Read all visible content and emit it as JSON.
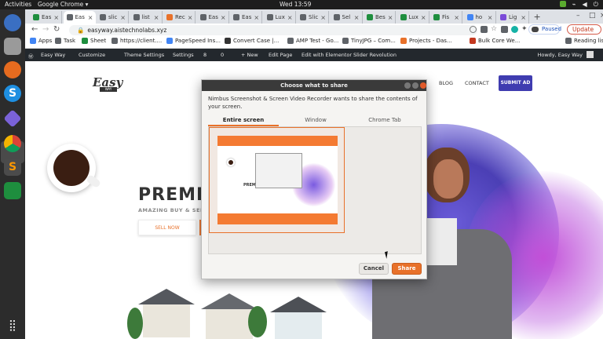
{
  "system": {
    "activities": "Activities",
    "app_name": "Google Chrome ▾",
    "clock": "Wed 13:59"
  },
  "dock": {
    "icons": [
      "thunderbird-icon",
      "files-icon",
      "firefox-icon",
      "skype-icon",
      "obsidian-icon",
      "chrome-icon",
      "sublime-icon",
      "sheets-icon",
      "app-grid-icon"
    ]
  },
  "browser": {
    "tabs": [
      {
        "label": "Eas",
        "color": "#1e8e3e"
      },
      {
        "label": "Eas",
        "color": "#5f6368"
      },
      {
        "label": "slic",
        "color": "#5f6368"
      },
      {
        "label": "list",
        "color": "#5f6368"
      },
      {
        "label": "Rec",
        "color": "#e8712a"
      },
      {
        "label": "Eas",
        "color": "#5f6368"
      },
      {
        "label": "Eas",
        "color": "#5f6368"
      },
      {
        "label": "Lux",
        "color": "#5f6368"
      },
      {
        "label": "Slic",
        "color": "#5f6368"
      },
      {
        "label": "Sel",
        "color": "#5f6368"
      },
      {
        "label": "Bes",
        "color": "#1e8e3e"
      },
      {
        "label": "Lux",
        "color": "#1e8e3e"
      },
      {
        "label": "Fis",
        "color": "#1e8e3e"
      },
      {
        "label": "ho",
        "color": "#4285f4"
      },
      {
        "label": "Lig",
        "color": "#7b4bd8"
      }
    ],
    "active_tab_index": 1,
    "url": "easyway.aistechnolabs.xyz",
    "paused_label": "Paused",
    "update_label": "Update",
    "bookmarks": [
      {
        "label": "Apps",
        "color": "#4285f4"
      },
      {
        "label": "Task",
        "color": "#5f6368"
      },
      {
        "label": "Sheet",
        "color": "#1e8e3e"
      },
      {
        "label": "https://client....",
        "color": "#5f6368"
      },
      {
        "label": "PageSpeed Ins...",
        "color": "#4285f4"
      },
      {
        "label": "Convert Case |...",
        "color": "#333333"
      },
      {
        "label": "AMP Test - Go...",
        "color": "#5f6368"
      },
      {
        "label": "TinyJPG – Com...",
        "color": "#5f6368"
      },
      {
        "label": "Projects - Das...",
        "color": "#e8712a"
      },
      {
        "label": "Bulk Core We...",
        "color": "#c3381f"
      }
    ],
    "reading_list": "Reading list"
  },
  "wp_admin_bar": {
    "items": [
      "Easy Way",
      "Customize",
      "Theme Settings",
      "Settings",
      "8",
      "0",
      "+ New",
      "Edit Page",
      "Edit with Elementor",
      "Slider Revolution"
    ],
    "howdy": "Howdy, Easy Way"
  },
  "site": {
    "logo": "Easy",
    "logo_sub": "WAY",
    "nav": [
      "BLOG",
      "CONTACT"
    ],
    "submit_ad": "SUBMIT AD",
    "hero_title": "PREMIU",
    "hero_sub": "AMAZING BUY & SELL C",
    "sell_now": "SELL NOW"
  },
  "dialog": {
    "title": "Choose what to share",
    "message": "Nimbus Screenshot & Screen Video Recorder wants to share the contents of your screen.",
    "tabs": [
      "Entire screen",
      "Window",
      "Chrome Tab"
    ],
    "active_tab_index": 0,
    "thumb_title": "PREMI",
    "cancel_label": "Cancel",
    "share_label": "Share",
    "accent_color": "#e8712a"
  }
}
